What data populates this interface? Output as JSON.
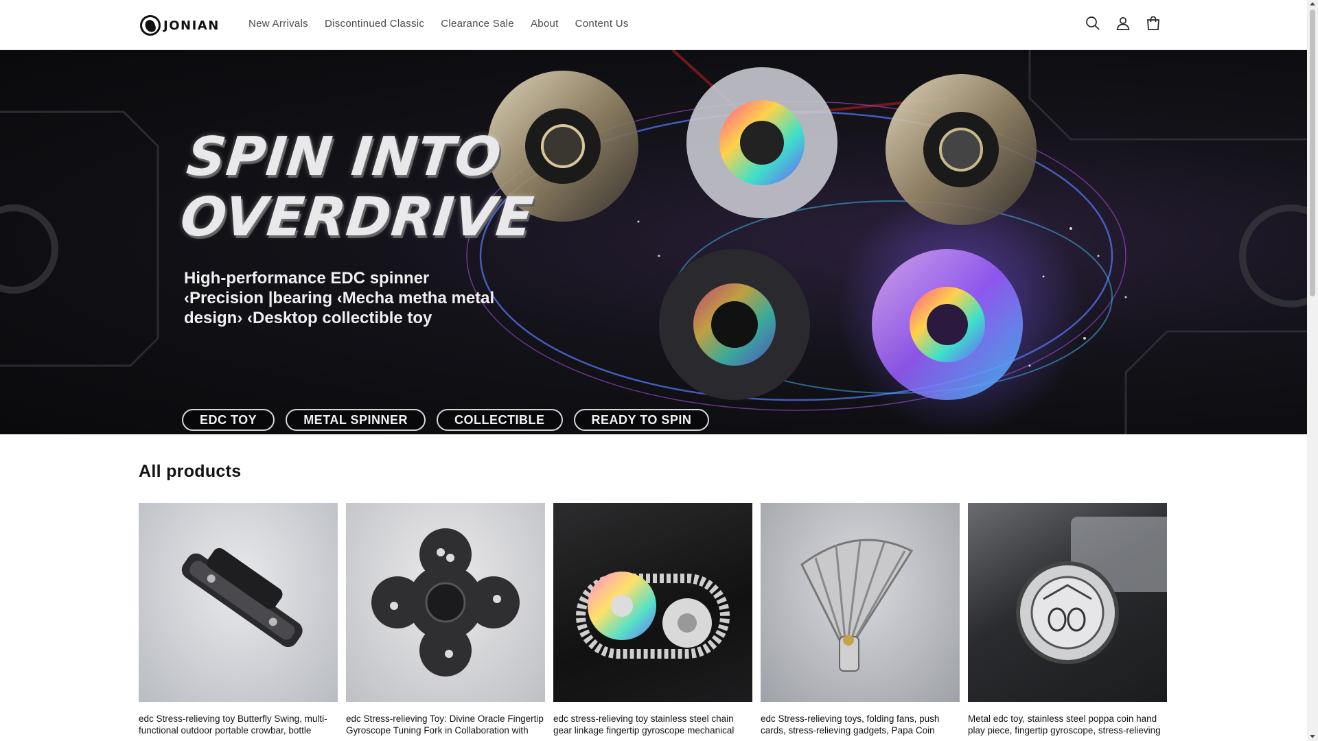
{
  "header": {
    "logo_text": "JONIAN",
    "nav": [
      {
        "label": "New Arrivals"
      },
      {
        "label": "Discontinued Classic"
      },
      {
        "label": "Clearance Sale"
      },
      {
        "label": "About"
      },
      {
        "label": "Content Us"
      }
    ],
    "icons": [
      "search-icon",
      "account-icon",
      "cart-icon"
    ]
  },
  "hero": {
    "title_line1": "SPIN INTO",
    "title_line2": "OVERDRIVE",
    "subtitle": "High-performance EDC spinner ‹Precision |bearing ‹Mecha metha metal design› ‹Desktop collectible toy",
    "tags": [
      "EDC TOY",
      "METAL SPINNER",
      "COLLECTIBLE",
      "READY TO SPIN"
    ]
  },
  "products": {
    "section_title": "All products",
    "items": [
      {
        "title": "edc Stress-relieving toy Butterfly Swing, multi-functional outdoor portable crowbar, bottle opening tie wrench, mechanical design"
      },
      {
        "title": "edc Stress-relieving Toy: Divine Oracle Fingertip Gyroscope Tuning Fork in Collaboration with Divine Push, Alloy Hand Play Piece, cutting"
      },
      {
        "title": "edc stress-relieving toy stainless steel chain gear linkage fingertip gyroscope mechanical hand play piece anodized finish"
      },
      {
        "title": "edc Stress-relieving toys, folding fans, push cards, stress-relieving gadgets, Papa Coin hand-held toys, Pop Coin metal play"
      },
      {
        "title": "Metal edc toy, stainless steel poppa coin hand play piece, fingertip gyroscope, stress-relieving black technology decompression toy"
      }
    ]
  }
}
